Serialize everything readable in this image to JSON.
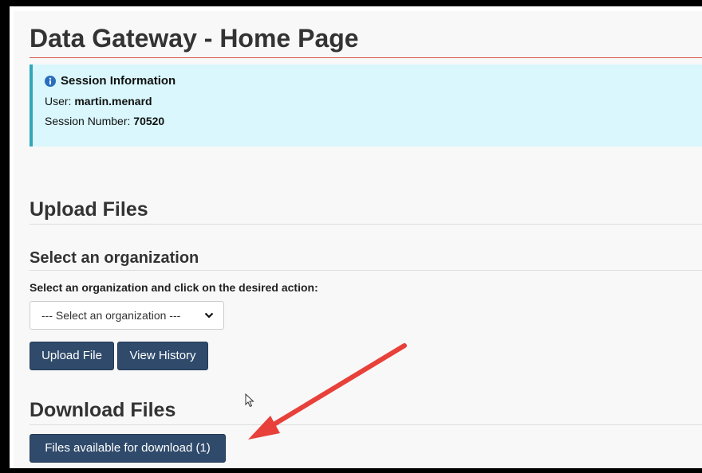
{
  "page": {
    "title": "Data Gateway - Home Page"
  },
  "session": {
    "heading": "Session Information",
    "user_label": "User:",
    "user_value": "martin.menard",
    "session_label": "Session Number:",
    "session_value": "70520"
  },
  "upload": {
    "heading": "Upload Files",
    "subheading": "Select an organization",
    "prompt": "Select an organization and click on the desired action:",
    "select_value": "--- Select an organization ---",
    "upload_button": "Upload File",
    "history_button": "View History"
  },
  "download": {
    "heading": "Download Files",
    "files_button": "Files available for download (1)"
  },
  "colors": {
    "button": "#2f4a6b",
    "info_bg": "#d9f7fc",
    "info_border": "#31a8b8",
    "title_rule": "#d9534f",
    "annotation_arrow": "#e8403a"
  }
}
